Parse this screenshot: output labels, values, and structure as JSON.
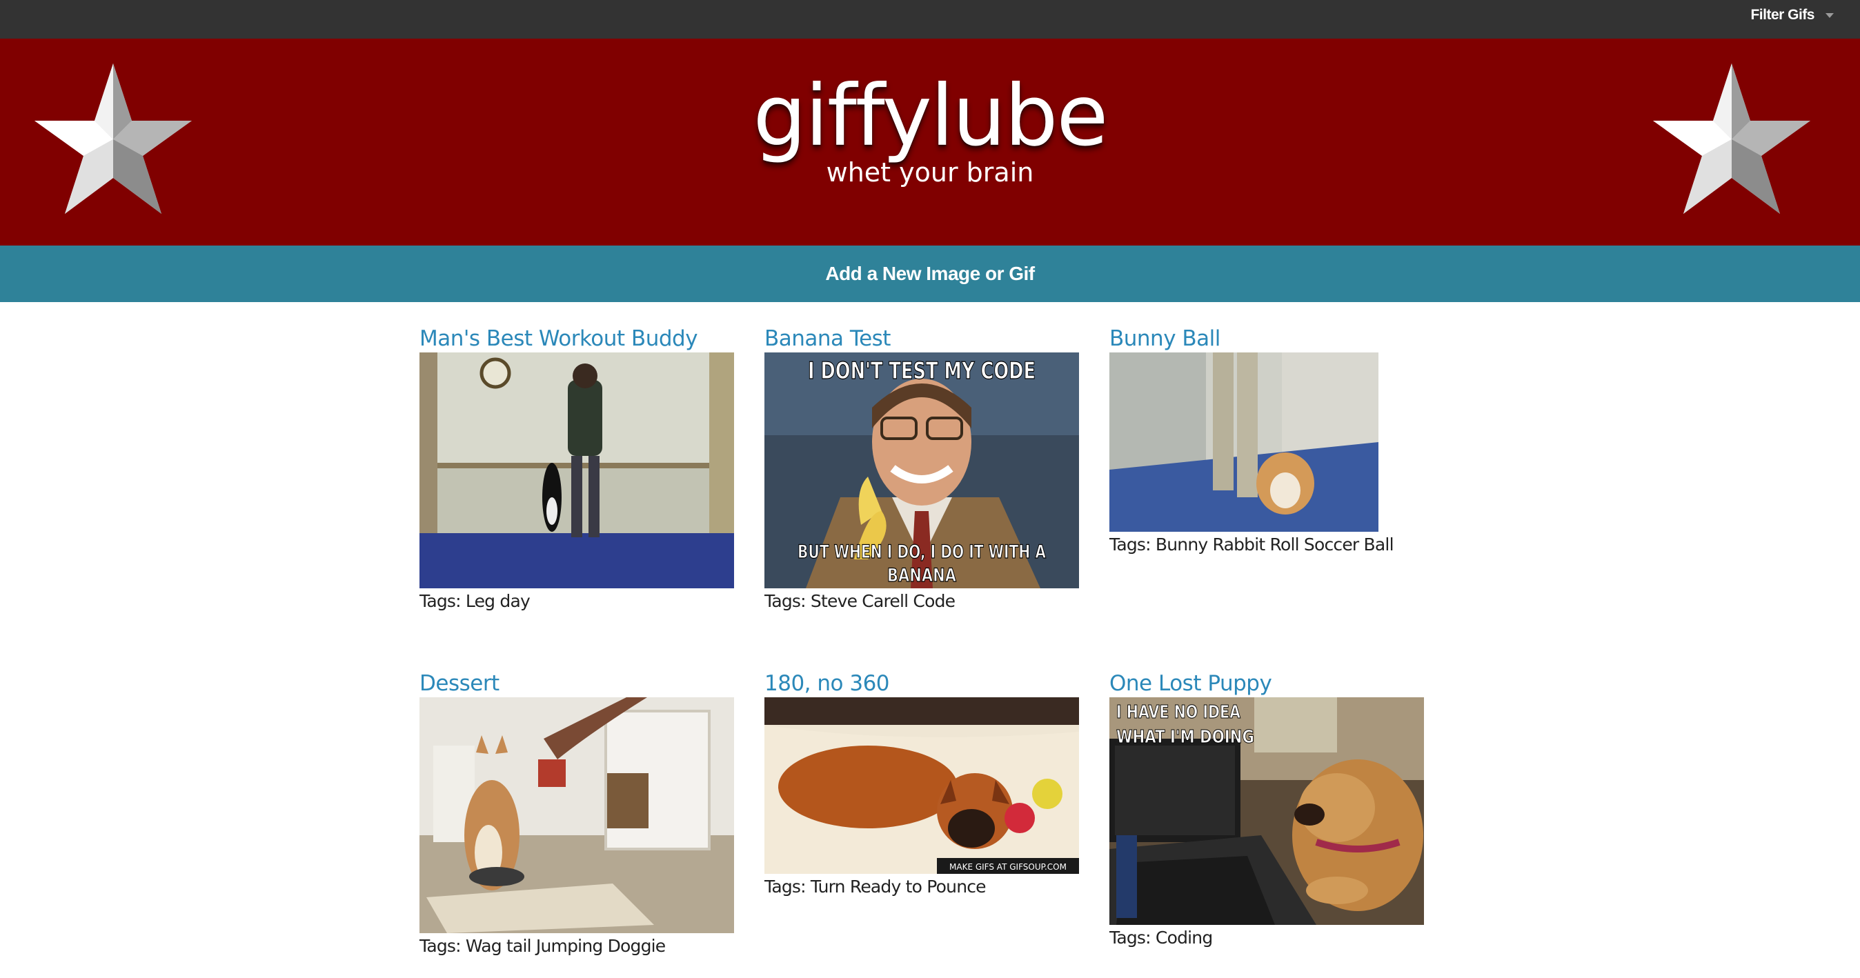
{
  "topbar": {
    "filter_label": "Filter Gifs"
  },
  "hero": {
    "title": "giffylube",
    "tagline": "whet your brain"
  },
  "add_link": "Add a New Image or Gif",
  "gifs": [
    {
      "title": "Man's Best Workout Buddy",
      "tags": "Tags: Leg day"
    },
    {
      "title": "Banana Test",
      "tags": "Tags: Steve Carell Code",
      "caption_top": "I DON'T TEST MY CODE",
      "caption_bottom_1": "BUT WHEN I DO, I DO IT WITH A",
      "caption_bottom_2": "BANANA"
    },
    {
      "title": "Bunny Ball",
      "tags": "Tags: Bunny Rabbit Roll Soccer Ball"
    },
    {
      "title": "Dessert",
      "tags": "Tags: Wag tail Jumping Doggie"
    },
    {
      "title": "180, no 360",
      "tags": "Tags: Turn Ready to Pounce",
      "watermark": "MAKE GIFS AT GIFSOUP.COM"
    },
    {
      "title": "One Lost Puppy",
      "tags": "Tags: Coding",
      "caption_1": "I HAVE NO IDEA",
      "caption_2": "WHAT I'M DOING"
    }
  ]
}
